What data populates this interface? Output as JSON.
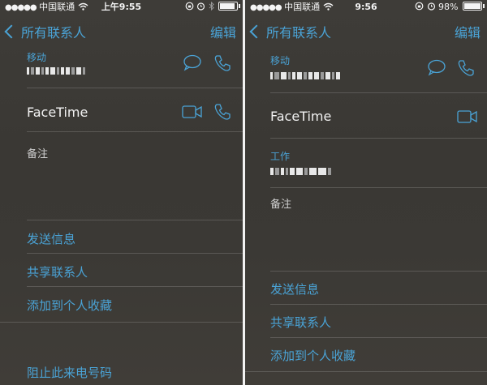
{
  "left": {
    "status": {
      "signal": "●●●●●",
      "carrier": "中国联通",
      "time": "上午9:55"
    },
    "nav": {
      "back_label": "所有联系人",
      "edit_label": "编辑"
    },
    "phone": {
      "label": "移动"
    },
    "facetime": {
      "label": "FaceTime"
    },
    "notes": {
      "label": "备注"
    },
    "actions": {
      "send_message": "发送信息",
      "share_contact": "共享联系人",
      "add_favorite": "添加到个人收藏",
      "block_caller": "阻止此来电号码"
    },
    "icons": {
      "message": "message-bubble-icon",
      "call": "phone-icon",
      "video": "video-camera-icon",
      "wifi": "wifi-icon",
      "alarm": "alarm-clock-icon",
      "rotation": "rotation-lock-icon",
      "bluetooth": "bluetooth-icon",
      "battery": "battery-icon"
    }
  },
  "right": {
    "status": {
      "signal": "●●●●●",
      "carrier": "中国联通",
      "time": "9:56",
      "battery_text": "98%",
      "battery_level": 0.98
    },
    "nav": {
      "back_label": "所有联系人",
      "edit_label": "编辑"
    },
    "phone": {
      "label": "移动"
    },
    "facetime": {
      "label": "FaceTime"
    },
    "work": {
      "label": "工作"
    },
    "notes": {
      "label": "备注"
    },
    "actions": {
      "send_message": "发送信息",
      "share_contact": "共享联系人",
      "add_favorite": "添加到个人收藏"
    }
  },
  "colors": {
    "accent": "#4aa3d6",
    "background": "#3c3a36",
    "text": "#f2f2f2",
    "separator": "#ffffff29"
  }
}
